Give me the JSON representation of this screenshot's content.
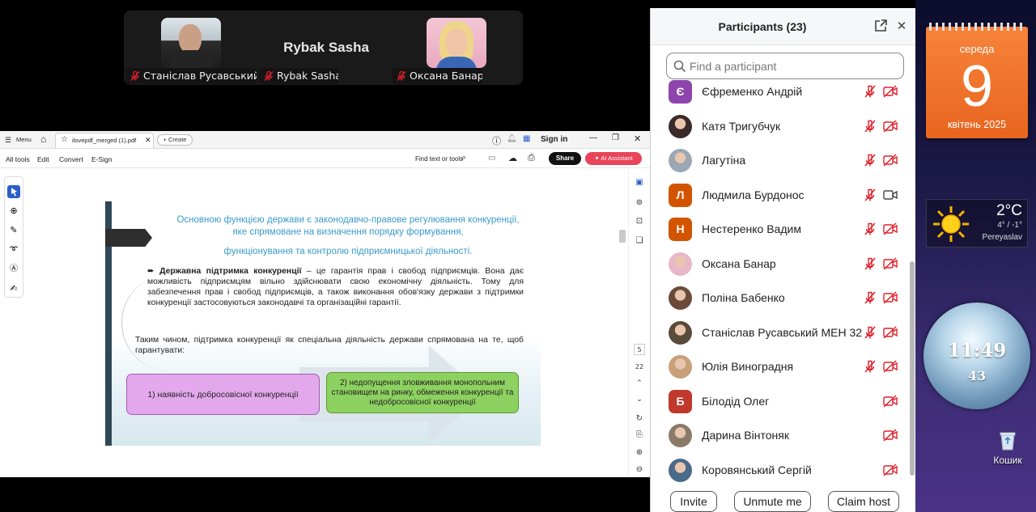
{
  "meeting": {
    "speaker_name": "Rybak Sasha",
    "tiles": [
      {
        "name": "Станіслав Русавський..."
      },
      {
        "name": "Rybak Sasha"
      },
      {
        "name": "Оксана Банар"
      }
    ]
  },
  "acrobat": {
    "menu_label": "Menu",
    "tab_name": "ilovepdf_merged (1).pdf",
    "create_label": "Create",
    "sign_in": "Sign in",
    "tools": [
      "All tools",
      "Edit",
      "Convert",
      "E-Sign"
    ],
    "find_label": "Find text or tools",
    "share_label": "Share",
    "ai_label": "AI Assistant",
    "page_current": "5",
    "page_total": "22"
  },
  "slide": {
    "title_line1": "Основною функцією держави є законодавчо-правове регулювання конкуренції, яке спрямоване на визначення порядку формування,",
    "title_line2": "функціонування та контролю підприємницької діяльності.",
    "bullet_bold": "Державна підтримка конкуренції",
    "bullet_text": " – це гарантія прав і свобод підприємців. Вона дає можливість підприємцям вільно здійснювати свою економічну діяльність. Тому для забезпечення прав і свобод підприємців, а також виконання обов'язку держави з підтримки конкуренції застосовуються законодавчі та організаційні гарантії.",
    "conclusion": "Таким чином, підтримка конкуренції як спеціальна діяльність держави спрямована на те, щоб гарантувати:",
    "box1": "1) наявність добросовісної конкуренції",
    "box2": "2) недопущення зловживання монопольним становищем на ринку, обмеження конкуренції та недобросовісної конкуренції"
  },
  "participants": {
    "title": "Participants (23)",
    "search_placeholder": "Find a participant",
    "list": [
      {
        "name": "Єфременко Андрій",
        "initial": "Є",
        "color": "#8e44ad",
        "mic": "muted",
        "cam": "off"
      },
      {
        "name": "Катя Тригубчук",
        "initial": "",
        "color": "#3a2a2a",
        "mic": "muted",
        "cam": "off"
      },
      {
        "name": "Лагутіна",
        "initial": "",
        "color": "#9aa7b5",
        "mic": "muted",
        "cam": "off"
      },
      {
        "name": "Людмила Бурдонос",
        "initial": "Л",
        "color": "#d35400",
        "mic": "muted",
        "cam": "on"
      },
      {
        "name": "Нестеренко Вадим",
        "initial": "Н",
        "color": "#d35400",
        "mic": "muted",
        "cam": "off"
      },
      {
        "name": "Оксана Банар",
        "initial": "",
        "color": "#e8b7c8",
        "mic": "muted",
        "cam": "off"
      },
      {
        "name": "Поліна Бабенко",
        "initial": "",
        "color": "#6b4a3a",
        "mic": "muted",
        "cam": "off"
      },
      {
        "name": "Станіслав Русавський МЕН 32",
        "initial": "",
        "color": "#5a4a3a",
        "mic": "muted",
        "cam": "off"
      },
      {
        "name": "Юлія Виноградня",
        "initial": "",
        "color": "#c8a07a",
        "mic": "muted",
        "cam": "off"
      },
      {
        "name": "Білодід Олег",
        "initial": "Б",
        "color": "#c0392b",
        "mic": "none",
        "cam": "off"
      },
      {
        "name": "Дарина Вінтоняк",
        "initial": "",
        "color": "#8a7a6a",
        "mic": "none",
        "cam": "off"
      },
      {
        "name": "Коровянський Сергій",
        "initial": "",
        "color": "#4a6a8a",
        "mic": "none",
        "cam": "off"
      }
    ],
    "buttons": {
      "invite": "Invite",
      "unmute": "Unmute me",
      "claim": "Claim host"
    }
  },
  "desktop": {
    "calendar": {
      "weekday": "середа",
      "day": "9",
      "month_year": "квітень 2025"
    },
    "weather": {
      "temp": "2°C",
      "range": "4° / -1°",
      "city": "Pereyaslav"
    },
    "clock": {
      "time": "11:49",
      "seconds": "43"
    },
    "recycle_label": "Кошик"
  },
  "colors": {
    "muted_red": "#e0202a",
    "ai_pink": "#e8445a",
    "calendar_orange": "#f07a32"
  }
}
